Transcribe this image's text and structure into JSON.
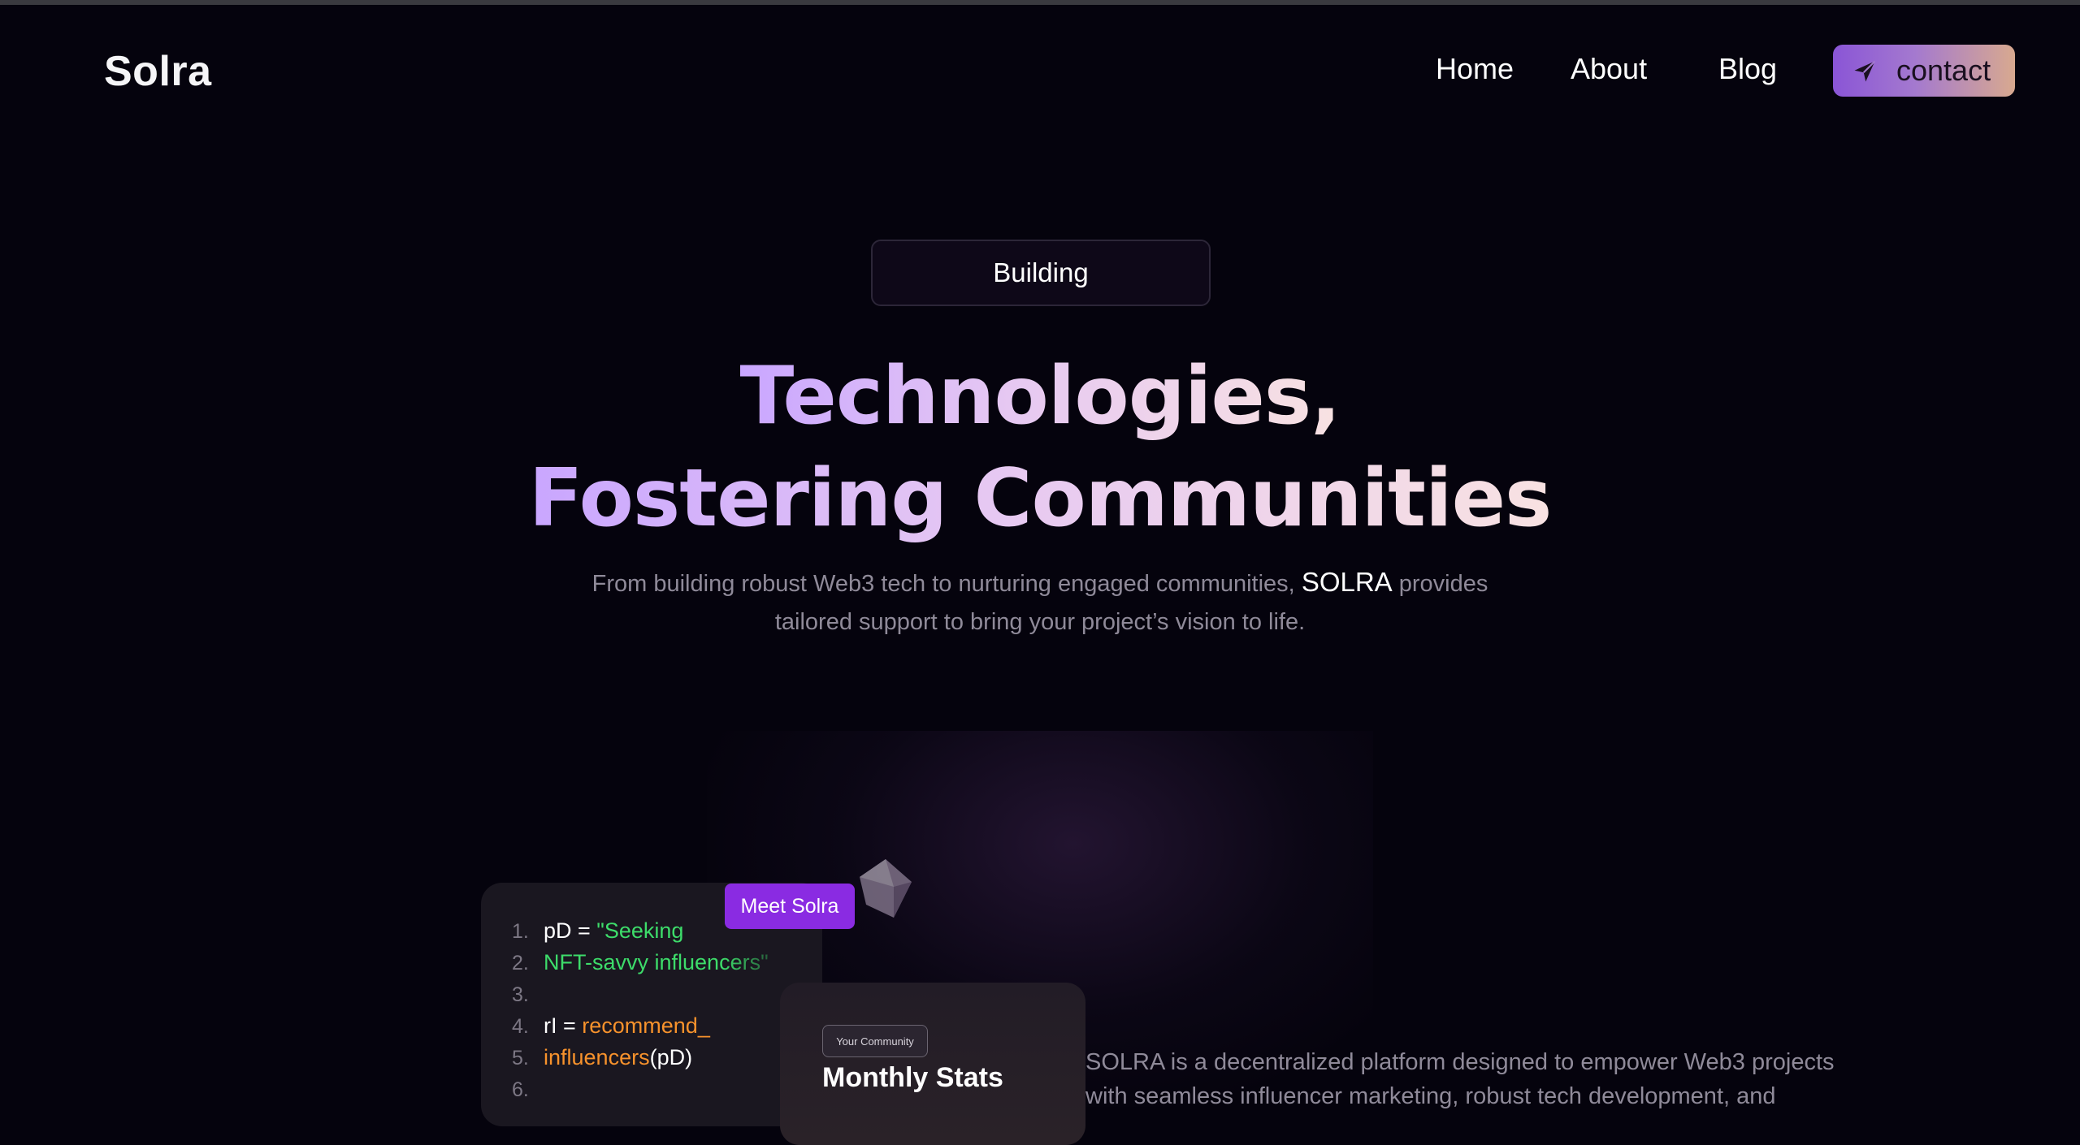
{
  "nav": {
    "logo": "Solra",
    "links": [
      "Home",
      "About",
      "Blog"
    ],
    "contact_label": "contact",
    "contact_icon": "send-icon"
  },
  "hero": {
    "pill_label": "Building",
    "title_line1": "Technologies,",
    "title_line2": "Fostering Communities",
    "subtitle_before": "From building robust Web3 tech to nurturing engaged communities, ",
    "subtitle_brand": "SOLRA",
    "subtitle_after": " provides tailored support to bring your project’s vision to life."
  },
  "code_card": {
    "lines": [
      {
        "num": "1.",
        "parts": [
          {
            "t": "pD = ",
            "c": "white"
          },
          {
            "t": "\"Seeking",
            "c": "green"
          }
        ]
      },
      {
        "num": "2.",
        "parts": [
          {
            "t": "NFT-savvy influencers\"",
            "c": "green"
          }
        ]
      },
      {
        "num": "3.",
        "parts": []
      },
      {
        "num": "4.",
        "parts": [
          {
            "t": "rI = ",
            "c": "white"
          },
          {
            "t": "recommend_",
            "c": "orange"
          }
        ]
      },
      {
        "num": "5.",
        "parts": [
          {
            "t": "influencers",
            "c": "orange"
          },
          {
            "t": "(pD)",
            "c": "white"
          }
        ]
      },
      {
        "num": "6.",
        "parts": []
      }
    ]
  },
  "meet_badge": "Meet Solra",
  "stats_card": {
    "pill": "Your Community",
    "title": "Monthly Stats"
  },
  "description": "SOLRA is a decentralized platform designed to empower Web3 projects with seamless influencer marketing, robust tech development, and",
  "colors": {
    "background": "#05030d",
    "accent_purple": "#8a2be2",
    "code_green": "#3ddc6a",
    "code_orange": "#f7922c"
  }
}
